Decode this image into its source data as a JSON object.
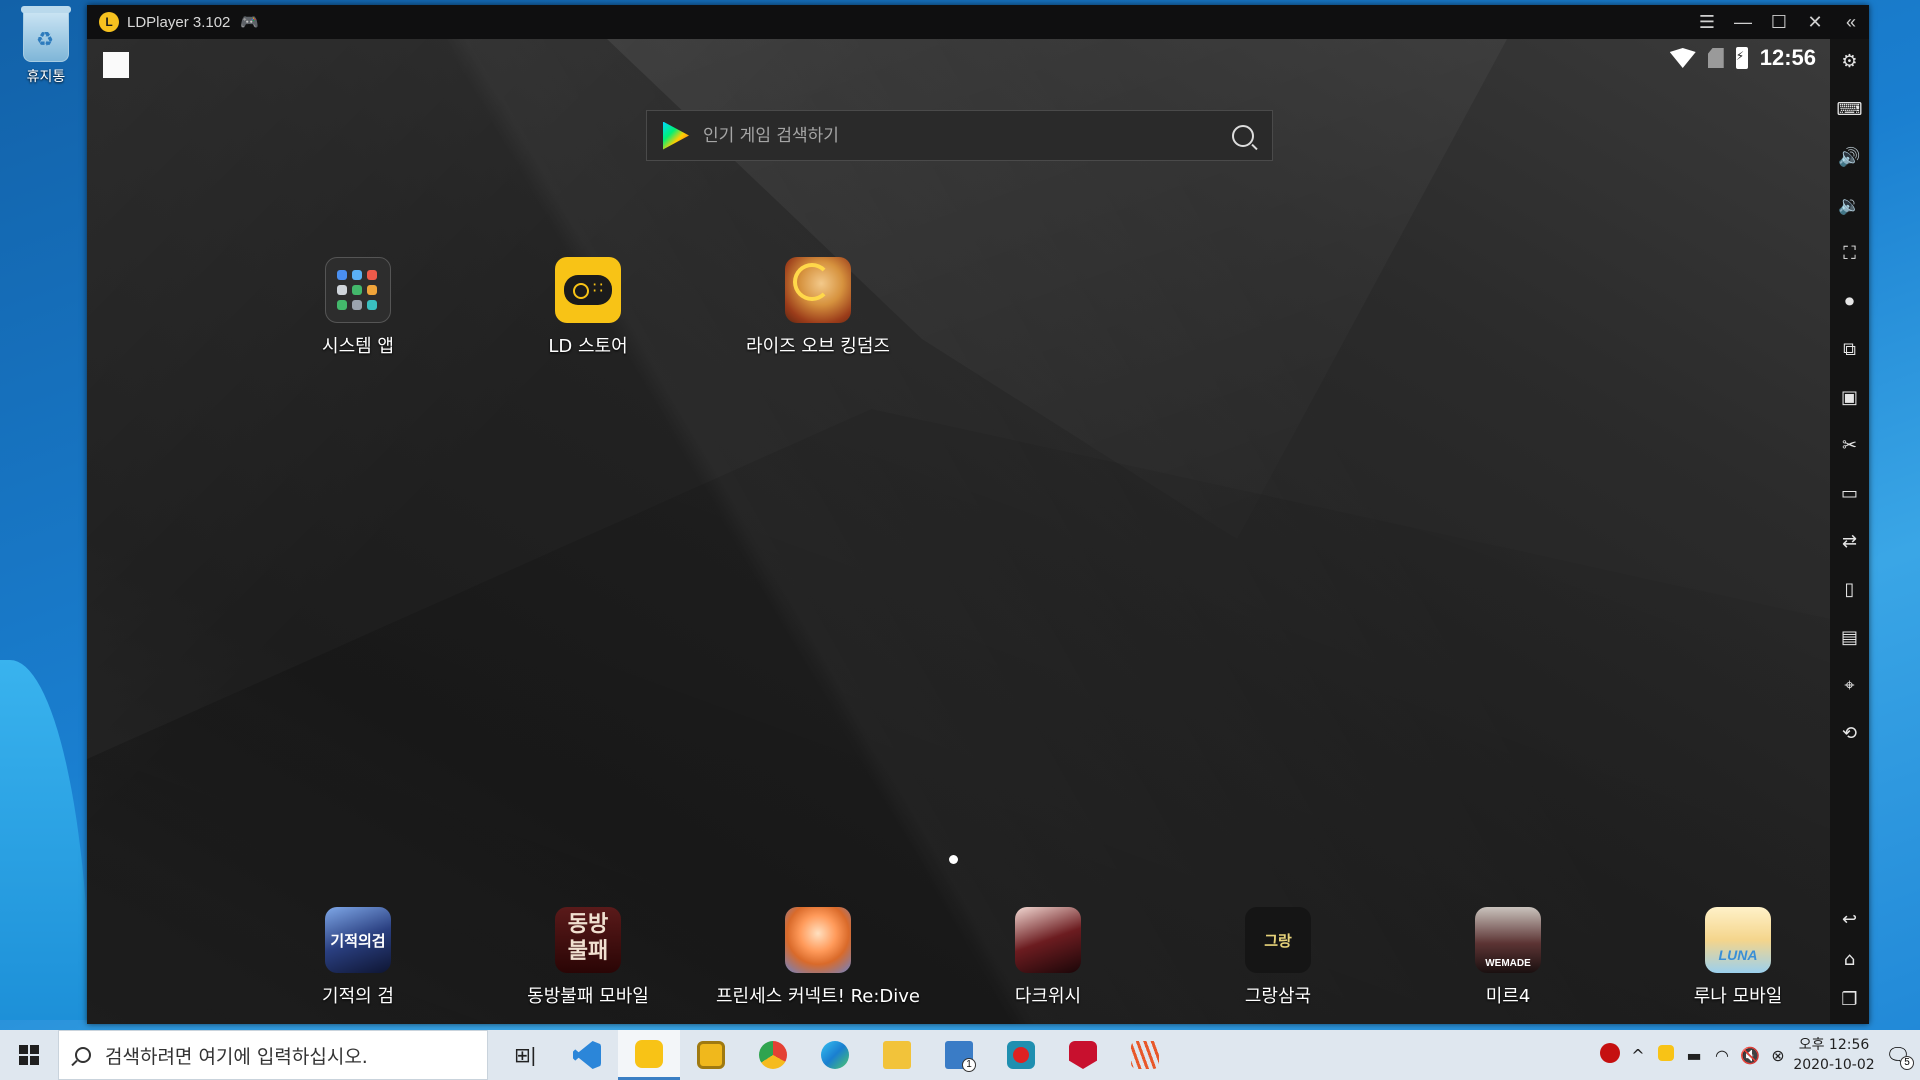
{
  "desktop": {
    "recycle_bin_label": "휴지통"
  },
  "window": {
    "title": "LDPlayer 3.102",
    "controls": [
      "menu-icon",
      "minimize-icon",
      "maximize-icon",
      "close-icon",
      "collapse-sidebar-icon"
    ]
  },
  "android": {
    "status_clock": "12:56",
    "search_placeholder": "인기 게임 검색하기",
    "top_apps": [
      {
        "label": "시스템 앱",
        "icon": "system-apps-folder"
      },
      {
        "label": "LD 스토어",
        "icon": "ld-store"
      },
      {
        "label": "라이즈 오브 킹덤즈",
        "icon": "rise-of-kingdoms"
      }
    ],
    "dock_apps": [
      {
        "label": "기적의 검",
        "icon": "miracle-sword",
        "icon_text": "기적의검"
      },
      {
        "label": "동방불패 모바일",
        "icon": "dongbang-bulpae",
        "icon_text": "동방\n불패"
      },
      {
        "label": "프린세스 커넥트! Re:Dive",
        "icon": "princess-connect"
      },
      {
        "label": "다크위시",
        "icon": "darkwish"
      },
      {
        "label": "그랑삼국",
        "icon": "grand-three-kingdoms",
        "icon_text": "그랑"
      },
      {
        "label": "미르4",
        "icon": "mir4",
        "icon_text": "WEMADE"
      },
      {
        "label": "루나 모바일",
        "icon": "luna-mobile",
        "icon_text": "LUNA"
      }
    ],
    "page_indicator": {
      "current": 1,
      "total": 1
    }
  },
  "sidebar": {
    "tools": [
      "settings-icon",
      "keyboard-icon",
      "volume-up-icon",
      "volume-down-icon",
      "fullscreen-icon",
      "record-icon",
      "multi-instance-icon",
      "apk-install-icon",
      "scissors-icon",
      "video-icon",
      "sync-icon",
      "shake-icon",
      "display-icon",
      "location-icon",
      "rotate-icon"
    ],
    "nav": [
      "back-icon",
      "home-icon",
      "recents-icon"
    ]
  },
  "taskbar": {
    "search_placeholder": "검색하려면 여기에 입력하십시오.",
    "apps": [
      "task-view",
      "vscode",
      "ldplayer",
      "ld-multi",
      "chrome",
      "edge",
      "file-explorer",
      "mail",
      "app-red",
      "mcafee",
      "app-stripes"
    ],
    "mail_badge": "1",
    "clock_time": "오후 12:56",
    "clock_date": "2020-10-02",
    "notification_count": "5"
  },
  "colors": {
    "ld_yellow": "#f8c316",
    "window_bg": "#1b1b1b",
    "taskbar_bg": "#dfe7ef",
    "accent": "#3b7fc4"
  }
}
